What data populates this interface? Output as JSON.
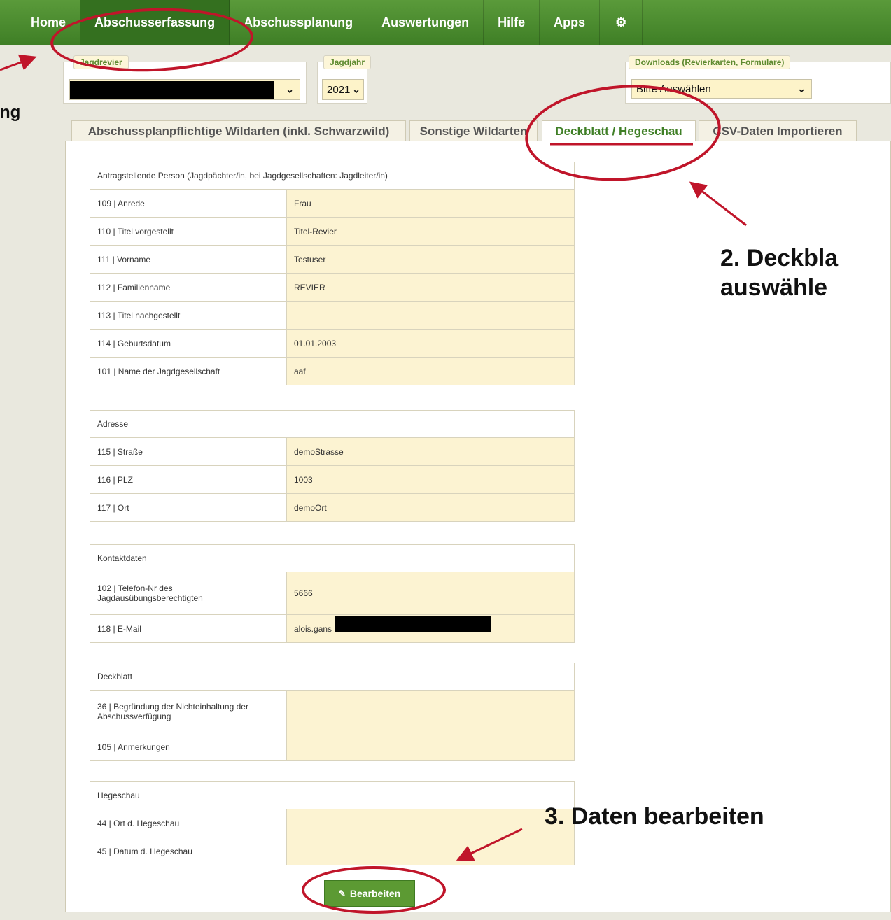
{
  "nav": {
    "items": [
      "Home",
      "Abschusserfassung",
      "Abschussplanung",
      "Auswertungen",
      "Hilfe",
      "Apps"
    ],
    "active": "Abschusserfassung",
    "gear_icon": "gear-icon"
  },
  "jagdrevier": {
    "legend": "Jagdrevier",
    "value": ""
  },
  "jagdjahr": {
    "legend": "Jagdjahr",
    "value": "2021"
  },
  "downloads": {
    "legend": "Downloads (Revierkarten, Formulare)",
    "value": "Bitte Auswählen"
  },
  "tabs": [
    "Abschussplanpflichtige Wildarten (inkl. Schwarzwild)",
    "Sonstige Wildarten",
    "Deckblatt / Hegeschau",
    "CSV-Daten Importieren"
  ],
  "active_tab": "Deckblatt / Hegeschau",
  "sections": [
    {
      "title": "Antragstellende Person (Jagdpächter/in, bei Jagdgesellschaften: Jagdleiter/in)",
      "rows": [
        {
          "label": "109 | Anrede",
          "value": "Frau"
        },
        {
          "label": "110 | Titel vorgestellt",
          "value": "Titel-Revier"
        },
        {
          "label": "111 | Vorname",
          "value": "Testuser"
        },
        {
          "label": "112 | Familienname",
          "value": "REVIER"
        },
        {
          "label": "113 | Titel nachgestellt",
          "value": ""
        },
        {
          "label": "114 | Geburtsdatum",
          "value": "01.01.2003"
        },
        {
          "label": "101 | Name der Jagdgesellschaft",
          "value": "aaf"
        }
      ]
    },
    {
      "title": "Adresse",
      "rows": [
        {
          "label": "115 | Straße",
          "value": "demoStrasse"
        },
        {
          "label": "116 | PLZ",
          "value": "1003"
        },
        {
          "label": "117 | Ort",
          "value": "demoOrt"
        }
      ]
    },
    {
      "title": "Kontaktdaten",
      "rows": [
        {
          "label": "102 | Telefon-Nr des Jagdausübungsberechtigten",
          "value": "5666"
        },
        {
          "label": "118 | E-Mail",
          "value": "alois.gans"
        }
      ]
    },
    {
      "title": "Deckblatt",
      "rows": [
        {
          "label": "36 | Begründung der Nichteinhaltung der Abschussverfügung",
          "value": ""
        },
        {
          "label": "105 | Anmerkungen",
          "value": ""
        }
      ]
    },
    {
      "title": "Hegeschau",
      "rows": [
        {
          "label": "44 | Ort d. Hegeschau",
          "value": ""
        },
        {
          "label": "45 | Datum d. Hegeschau",
          "value": ""
        }
      ]
    }
  ],
  "edit_button": "Bearbeiten",
  "annotations": {
    "step1_fragment": "ng",
    "step2_line1": "2. Deckbla",
    "step2_line2": "auswähle",
    "step3": "3. Daten bearbeiten"
  },
  "colors": {
    "nav_green": "#3f7f26",
    "accent_red": "#c0152a",
    "field_yellow": "#fcf3d2"
  }
}
